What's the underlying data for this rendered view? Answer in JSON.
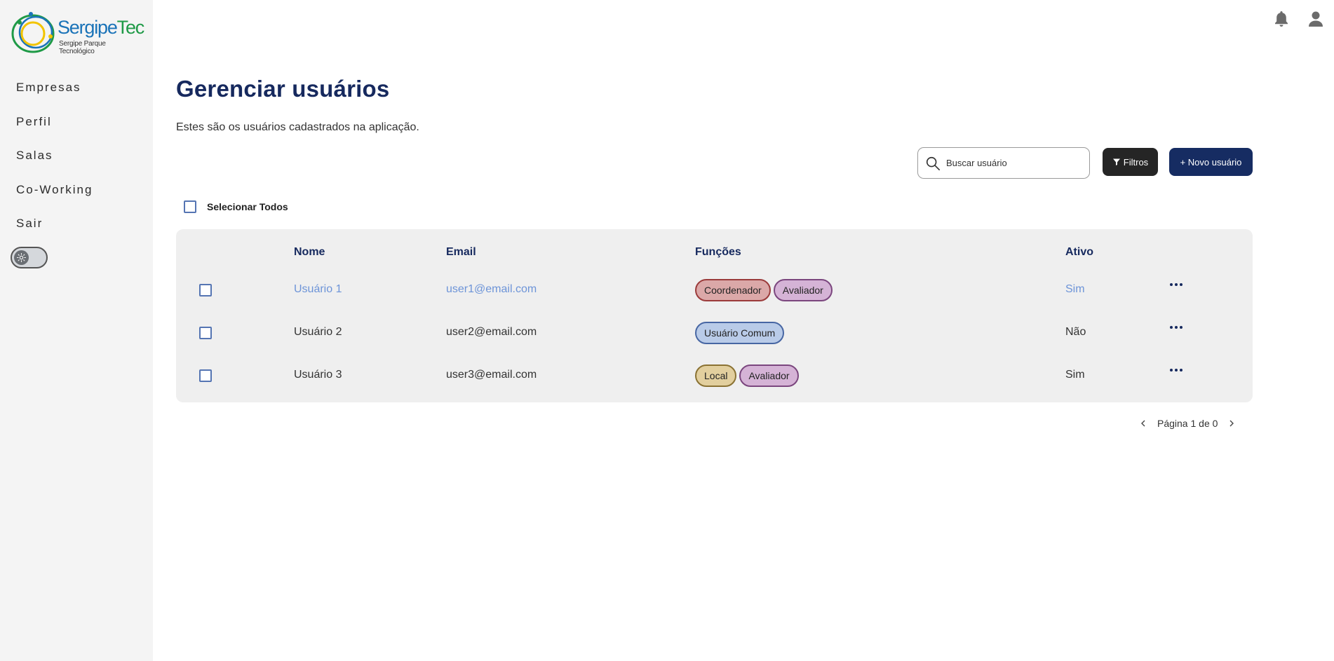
{
  "brand": {
    "name_part1": "Sergipe",
    "name_part2": "Tec",
    "tagline": "Sergipe Parque Tecnológico"
  },
  "sidebar": {
    "items": [
      {
        "label": "Empresas"
      },
      {
        "label": "Perfil"
      },
      {
        "label": "Salas"
      },
      {
        "label": "Co-Working"
      },
      {
        "label": "Sair"
      }
    ],
    "theme_toggle_icon": "sun-icon"
  },
  "header": {
    "icons": [
      "bell-icon",
      "user-icon"
    ]
  },
  "main": {
    "title": "Gerenciar usuários",
    "subtitle": "Estes são os usuários cadastrados na aplicação.",
    "search": {
      "placeholder": "Buscar usuário",
      "value": ""
    },
    "filter_button": "Filtros",
    "new_button": "+ Novo usuário",
    "select_all_label": "Selecionar Todos"
  },
  "table": {
    "columns": [
      "Nome",
      "Email",
      "Funções",
      "Ativo"
    ],
    "rows": [
      {
        "name": "Usuário 1",
        "email": "user1@email.com",
        "roles": [
          "Coordenador",
          "Avaliador"
        ],
        "active": "Sim",
        "highlighted": true
      },
      {
        "name": "Usuário 2",
        "email": "user2@email.com",
        "roles": [
          "Usuário Comum"
        ],
        "active": "Não",
        "highlighted": false
      },
      {
        "name": "Usuário 3",
        "email": "user3@email.com",
        "roles": [
          "Local",
          "Avaliador"
        ],
        "active": "Sim",
        "highlighted": false
      }
    ]
  },
  "role_colors": {
    "Coordenador": {
      "bg": "#dba8a8",
      "border": "#9b3b3b"
    },
    "Avaliador": {
      "bg": "#d5b3d6",
      "border": "#7b467e"
    },
    "Usuário Comum": {
      "bg": "#b9cbe8",
      "border": "#4766a3"
    },
    "Local": {
      "bg": "#e2cf9e",
      "border": "#8a7233"
    }
  },
  "pagination": {
    "text": "Página 1 de 0"
  },
  "colors": {
    "primary": "#16295e",
    "link": "#6d94d8",
    "dark_button": "#252525"
  }
}
